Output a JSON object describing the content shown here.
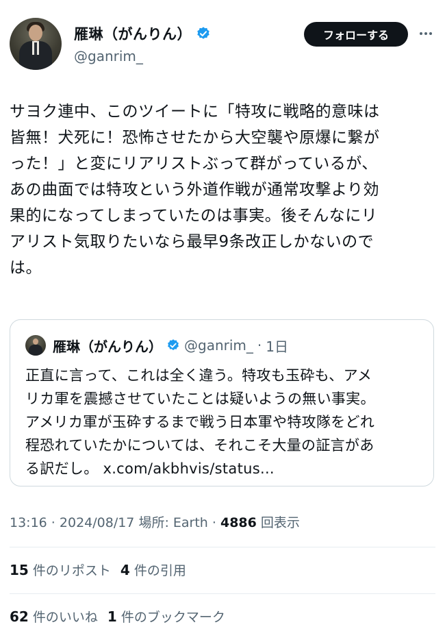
{
  "author": {
    "display_name": "雁琳（がんりん）",
    "handle": "@ganrim_",
    "verified": true
  },
  "follow_label": "フォローする",
  "more_icon": "more-horizontal-icon",
  "tweet": {
    "text_lines": [
      "サヨク連中、このツイートに「特攻に戦略的意味は",
      "皆無！犬死に！恐怖させたから大空襲や原爆に繋が",
      "った！」と変にリアリストぶって群がっているが、",
      "あの曲面では特攻という外道作戦が通常攻撃より効",
      "果的になってしまっていたのは事実。後そんなにリ",
      "アリスト気取りたいなら最早9条改正しかないので",
      "は。"
    ]
  },
  "quote": {
    "display_name": "雁琳（がんりん）",
    "handle": "@ganrim_",
    "time": "1日",
    "text_lines": [
      "正直に言って、これは全く違う。特攻も玉砕も、アメ",
      "リカ軍を震撼させていたことは疑いようの無い事実。",
      "アメリカ軍が玉砕するまで戦う日本軍や特攻隊をどれ",
      "程恐れていたかについては、それこそ大量の証言があ",
      "る訳だし。 x.com/akbhvis/status..."
    ]
  },
  "meta": {
    "time": "13:16",
    "date": "2024/08/17",
    "location": "場所: Earth",
    "views": "4886",
    "views_label": "回表示"
  },
  "stats": {
    "reposts": "15",
    "reposts_label": "件のリポスト",
    "quotes": "4",
    "quotes_label": "件の引用",
    "likes": "62",
    "likes_label": "件のいいね",
    "bookmarks": "1",
    "bookmarks_label": "件のブックマーク"
  },
  "colors": {
    "verified_blue": "#1d9bf0",
    "text_primary": "#0f1419",
    "text_secondary": "#536471",
    "border": "#cfd9de"
  }
}
